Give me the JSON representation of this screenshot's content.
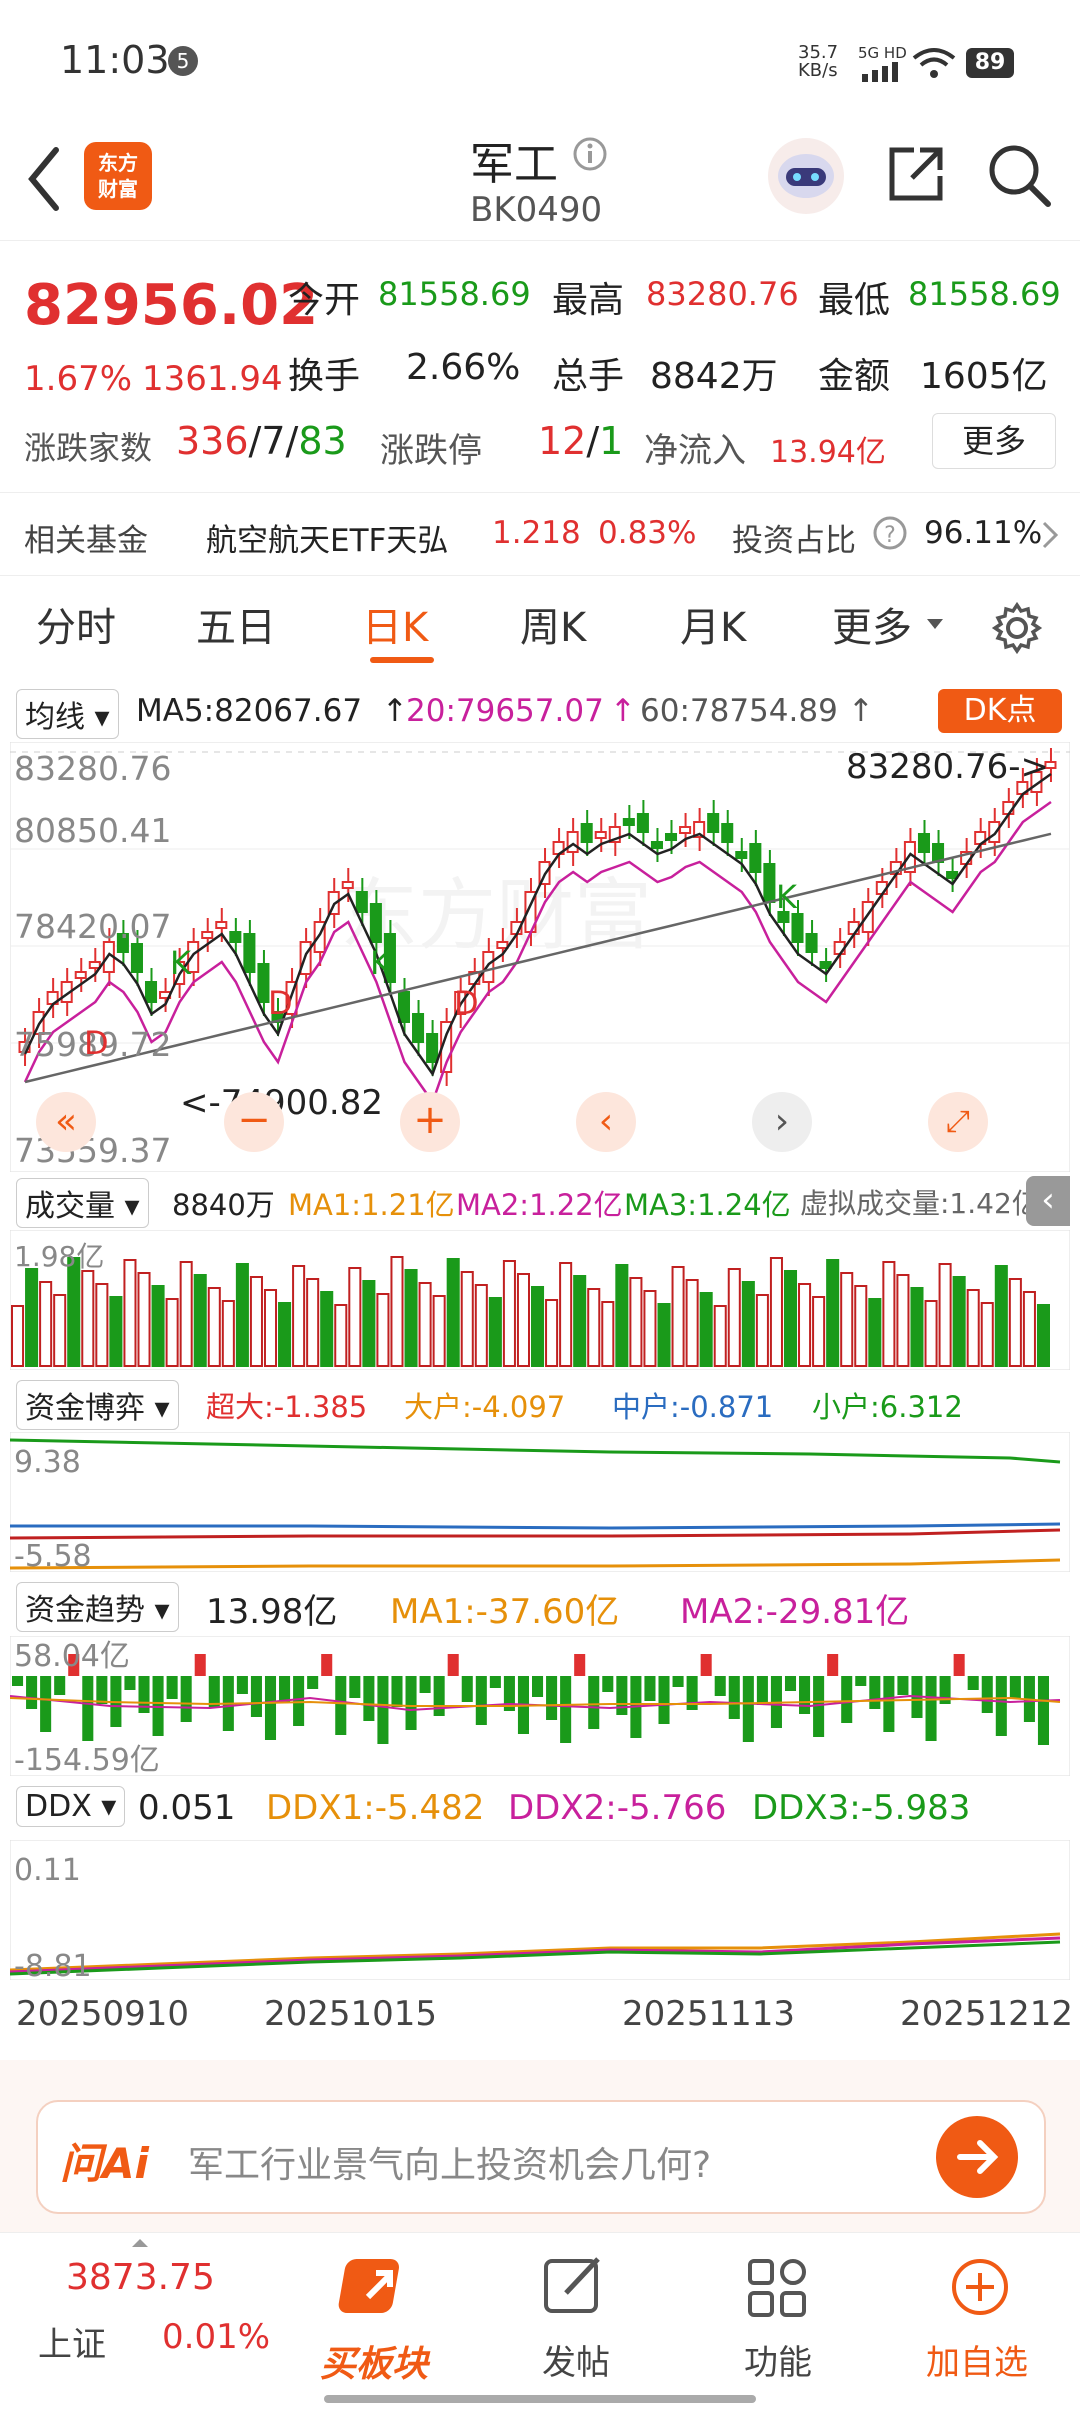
{
  "status": {
    "time": "11:03",
    "notif_count": "5",
    "net_speed_top": "35.7",
    "net_speed_bottom": "KB/s",
    "net_type": "5G HD",
    "battery": "89"
  },
  "header": {
    "logo_line1": "东方",
    "logo_line2": "财富",
    "title": "军工",
    "code": "BK0490"
  },
  "quote": {
    "price": "82956.02",
    "change_pct": "1.67%",
    "change": "1361.94",
    "open_label": "今开",
    "open": "81558.69",
    "high_label": "最高",
    "high": "83280.76",
    "low_label": "最低",
    "low": "81558.69",
    "turnover_label": "换手",
    "turnover": "2.66%",
    "volume_label": "总手",
    "volume": "8842万",
    "amount_label": "金额",
    "amount": "1605亿",
    "updown_label": "涨跌家数",
    "up": "336",
    "flat": "7",
    "down": "83",
    "limit_label": "涨跌停",
    "limit_up": "12",
    "limit_down": "1",
    "inflow_label": "净流入",
    "inflow": "13.94亿",
    "more_label": "更多"
  },
  "fund": {
    "label": "相关基金",
    "name": "航空航天ETF天弘",
    "price": "1.218",
    "pct": "0.83%",
    "ratio_label": "投资占比",
    "ratio": "96.11%"
  },
  "tabs": [
    "分时",
    "五日",
    "日K",
    "周K",
    "月K",
    "更多"
  ],
  "ma_line": {
    "selector": "均线",
    "ma5": "MA5:82067.67",
    "ma20": "20:79657.07",
    "ma60": "60:78754.89",
    "dk_label": "DK点"
  },
  "kchart": {
    "y_labels": [
      "83280.76",
      "80850.41",
      "78420.07",
      "75989.72",
      "73559.37"
    ],
    "max_marker": "83280.76->",
    "min_marker": "<-74900.82",
    "watermark": "东方财富"
  },
  "volume_line": {
    "selector": "成交量",
    "value": "8840万",
    "ma1": "MA1:1.21亿",
    "ma2": "MA2:1.22亿",
    "ma3": "MA3:1.24亿",
    "virtual": "虚拟成交量:1.42亿",
    "y_top": "1.98亿"
  },
  "capital_game": {
    "selector": "资金博弈",
    "super": "超大:-1.385",
    "large": "大户:-4.097",
    "mid": "中户:-0.871",
    "small": "小户:6.312",
    "y_top": "9.38",
    "y_bottom": "-5.58"
  },
  "capital_trend": {
    "selector": "资金趋势",
    "value": "13.98亿",
    "ma1": "MA1:-37.60亿",
    "ma2": "MA2:-29.81亿",
    "y_top": "58.04亿",
    "y_bottom": "-154.59亿"
  },
  "ddx": {
    "selector": "DDX",
    "value": "0.051",
    "ddx1": "DDX1:-5.482",
    "ddx2": "DDX2:-5.766",
    "ddx3": "DDX3:-5.983",
    "y_top": "0.11",
    "y_bottom": "-8.81"
  },
  "dates": [
    "20250910",
    "20251015",
    "20251113",
    "20251212"
  ],
  "ai": {
    "label": "问Ai",
    "prompt": "军工行业景气向上投资机会几何?"
  },
  "nav": {
    "index_value": "3873.75",
    "index_name": "上证",
    "index_pct": "0.01%",
    "buy_label": "买板块",
    "post_label": "发帖",
    "func_label": "功能",
    "add_label": "加自选"
  }
}
